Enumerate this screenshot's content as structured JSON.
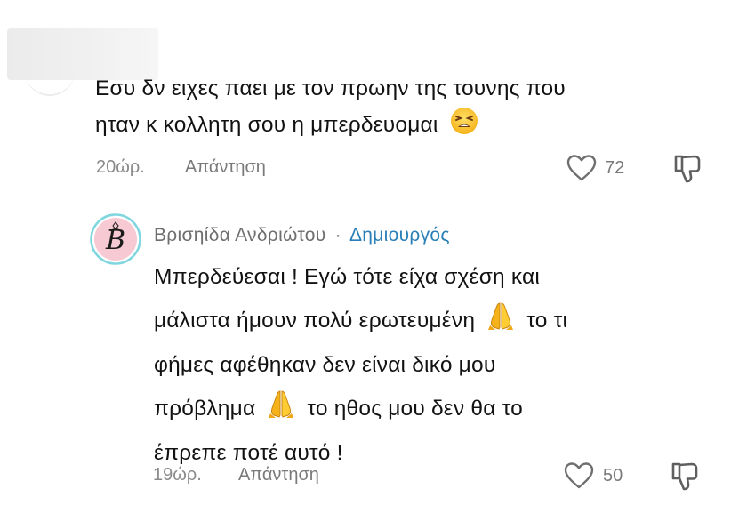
{
  "comment1": {
    "text_line1": "Εσυ δν ειχες παει με τον πρωην της τουνης που",
    "text_line2": "ηταν κ κολλητη σου η μπερδευομαι",
    "emoji": "tired-face-emoji",
    "time": "20ώρ.",
    "reply_label": "Απάντηση",
    "likes": "72",
    "icons": {
      "like": "heart-icon",
      "dislike": "thumbs-down-icon"
    }
  },
  "comment2": {
    "author": "Βρισηίδα Ανδριώτου",
    "separator": "·",
    "role": "Δημιουργός",
    "lines": [
      "Μπερδεύεσαι ! Εγώ τότε είχα σχέση και",
      "μάλιστα ήμουν πολύ ερωτευμένη",
      "το τι",
      "φήμες αφέθηκαν δεν είναι δικό μου",
      "πρόβλημα",
      "το ηθος μου δεν θα το",
      "έπρεπε ποτέ αυτό !"
    ],
    "emoji": "folded-hands-emoji",
    "time": "19ώρ.",
    "reply_label": "Απάντηση",
    "likes": "50",
    "icons": {
      "like": "heart-icon",
      "dislike": "thumbs-down-icon"
    }
  },
  "colors": {
    "creator": "#2a7fb8",
    "muted": "#8a8a8a",
    "text": "#121212",
    "avatar_ring": "#7fd6df",
    "avatar_bg": "#f6c9d3"
  }
}
